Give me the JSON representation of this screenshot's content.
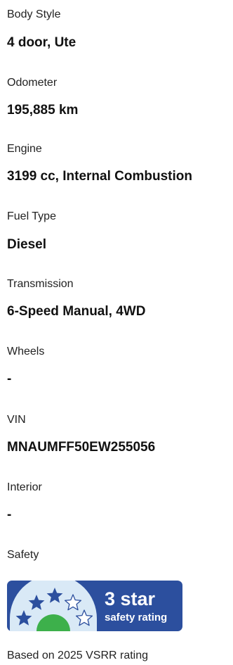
{
  "specs": [
    {
      "label": "Body Style",
      "value": "4 door, Ute"
    },
    {
      "label": "Odometer",
      "value": "195,885 km"
    },
    {
      "label": "Engine",
      "value": "3199 cc, Internal Combustion"
    },
    {
      "label": "Fuel Type",
      "value": "Diesel"
    },
    {
      "label": "Transmission",
      "value": "6-Speed Manual, 4WD"
    },
    {
      "label": "Wheels",
      "value": "-"
    },
    {
      "label": "VIN",
      "value": "MNAUMFF50EW255056"
    },
    {
      "label": "Interior",
      "value": "-"
    }
  ],
  "safety": {
    "label": "Safety",
    "badge_rating": "3 star",
    "badge_caption": "safety rating",
    "stars_filled": 3,
    "stars_total": 5,
    "footnote": "Based on 2025 VSRR rating"
  },
  "colors": {
    "badge_blue": "#2c4f9e",
    "badge_light": "#d9e9f6",
    "badge_green": "#3db04b"
  }
}
